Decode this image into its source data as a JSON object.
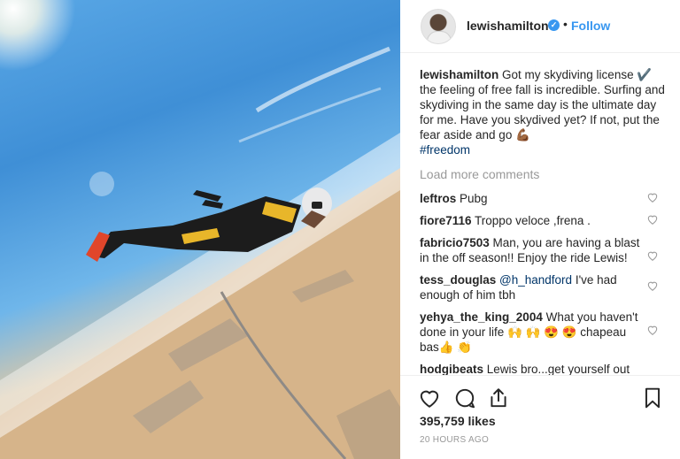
{
  "header": {
    "username": "lewishamilton",
    "verified_mark": "✓",
    "separator": "•",
    "follow_label": "Follow"
  },
  "caption": {
    "username": "lewishamilton",
    "text": " Got my skydiving license ✔️ the feeling of free fall is incredible. Surfing and skydiving in the same day is the ultimate day for me. Have you skydived yet? If not, put the fear aside and go 💪🏾",
    "hashtag": "#freedom"
  },
  "load_more_label": "Load more comments",
  "comments": [
    {
      "user": "leftros",
      "text": " Pubg"
    },
    {
      "user": "fiore7116",
      "text": " Troppo veloce ,frena ."
    },
    {
      "user": "fabricio7503",
      "text": " Man, you are having a blast in the off season!! Enjoy the ride Lewis!"
    },
    {
      "user": "tess_douglas",
      "mention": " @h_handford",
      "text": " I've had enough of him tbh"
    },
    {
      "user": "yehya_the_king_2004",
      "text": " What you haven't done in your life 🙌 🙌 😍 😍 chapeau bas👍 👏"
    },
    {
      "user": "hodgibeats",
      "text": " Lewis bro...get yourself out"
    }
  ],
  "likes_text": "395,759 likes",
  "timestamp": "20 HOURS AGO",
  "icons": {
    "like": "heart-icon",
    "comment": "comment-icon",
    "share": "share-icon",
    "save": "bookmark-icon"
  },
  "colors": {
    "accent": "#3897f0",
    "muted": "#999999",
    "text": "#262626",
    "hashtag": "#003569"
  }
}
